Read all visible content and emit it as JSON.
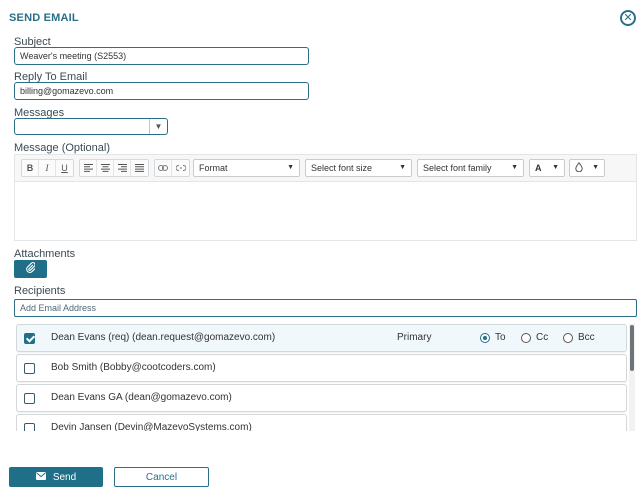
{
  "dialog": {
    "title": "SEND EMAIL",
    "close_glyph": "✕"
  },
  "subject": {
    "label": "Subject",
    "value": "Weaver's meeting (S2553)"
  },
  "reply_to": {
    "label": "Reply To Email",
    "value": "billing@gomazevo.com"
  },
  "messages": {
    "label": "Messages",
    "selected": ""
  },
  "message_optional": {
    "label": "Message (Optional)"
  },
  "toolbar": {
    "bold": "B",
    "italic": "I",
    "underline": "U",
    "format": "Format",
    "font_size": "Select font size",
    "font_family": "Select font family",
    "font_color": "A",
    "bg_color_icon": "droplet-icon"
  },
  "attachments": {
    "label": "Attachments",
    "icon": "paperclip-icon"
  },
  "recipients": {
    "label": "Recipients",
    "placeholder": "Add Email Address",
    "rows": [
      {
        "name": "Dean Evans (req) (dean.request@gomazevo.com)",
        "checked": true,
        "primary": "Primary",
        "to": "To",
        "cc": "Cc",
        "bcc": "Bcc",
        "selected_type": "To"
      },
      {
        "name": "Bob Smith (Bobby@cootcoders.com)",
        "checked": false
      },
      {
        "name": "Dean Evans GA (dean@gomazevo.com)",
        "checked": false
      },
      {
        "name": "Devin Jansen (Devin@MazevoSystems.com)",
        "checked": false
      }
    ]
  },
  "footer": {
    "send_label": "Send",
    "cancel_label": "Cancel"
  },
  "colors": {
    "accent": "#1f6f89",
    "title": "#2a6f87"
  }
}
